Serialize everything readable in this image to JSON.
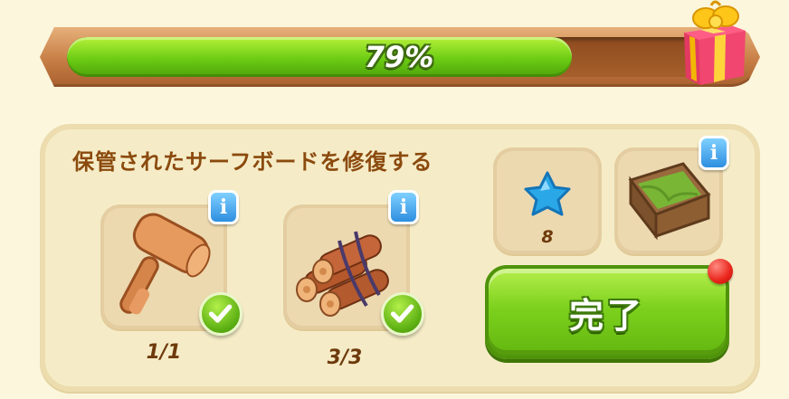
{
  "progress": {
    "percent_label": "79%",
    "fraction": 0.79,
    "colors": {
      "fill": "#6ccc13",
      "track": "#a65f2b",
      "frame": "#c77e45"
    },
    "reward_icon": "gift-box-icon"
  },
  "task": {
    "title": "保管されたサーフボードを修復する",
    "requirements": [
      {
        "icon": "wooden-mallet-icon",
        "count": "1/1",
        "completed": true,
        "info_icon": "info-icon",
        "check_icon": "checkmark-icon"
      },
      {
        "icon": "firewood-bundle-icon",
        "count": "3/3",
        "completed": true,
        "info_icon": "info-icon",
        "check_icon": "checkmark-icon"
      }
    ],
    "rewards": [
      {
        "icon": "blue-star-icon",
        "amount": "8"
      },
      {
        "icon": "grass-crate-icon",
        "info_icon": "info-icon"
      }
    ],
    "complete_button": {
      "label": "完了",
      "color": "#7dd11d",
      "has_notification": true,
      "notification_color": "#e9241b"
    }
  }
}
